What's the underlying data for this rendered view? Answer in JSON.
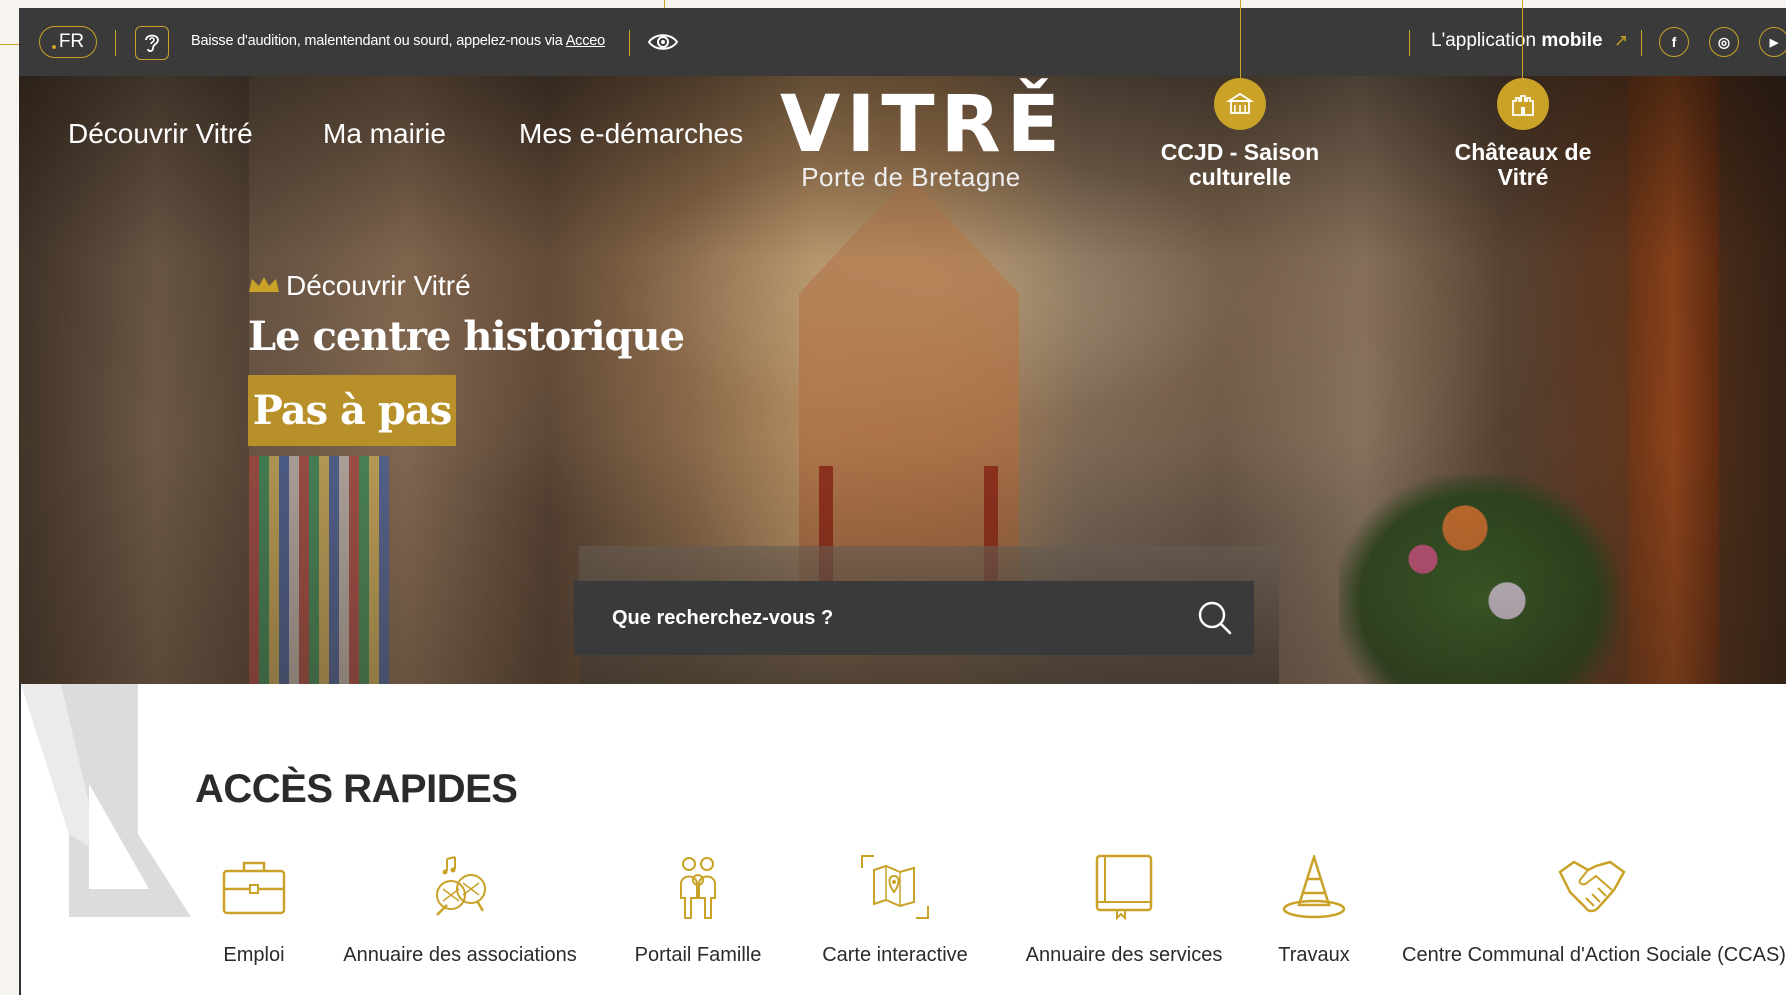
{
  "topbar": {
    "language": "FR",
    "accessibility_text": "Baisse d'audition, malentendant ou sourd, appelez-nous via",
    "accessibility_link": "Acceo",
    "app_link_prefix": "L'application",
    "app_link_bold": "mobile",
    "social": [
      {
        "name": "facebook",
        "glyph": "f"
      },
      {
        "name": "instagram",
        "glyph": "◎"
      },
      {
        "name": "youtube",
        "glyph": "▶"
      }
    ]
  },
  "nav": {
    "items": [
      "Découvrir Vitré",
      "Ma mairie",
      "Mes e-démarches"
    ]
  },
  "logo": {
    "word": "VITRĚ",
    "subtitle": "Porte de Bretagne"
  },
  "header_links": [
    {
      "label_line1": "CCJD - Saison",
      "label_line2": "culturelle",
      "icon": "theatre-icon"
    },
    {
      "label_line1": "Châteaux de",
      "label_line2": "Vitré",
      "icon": "castle-icon"
    }
  ],
  "hero": {
    "kicker": "Découvrir Vitré",
    "title": "Le centre historique",
    "cta": "Pas à pas"
  },
  "search": {
    "placeholder": "Que recherchez-vous ?"
  },
  "quick_access": {
    "title": "ACCÈS RAPIDES",
    "items": [
      {
        "label": "Emploi",
        "icon": "briefcase-icon"
      },
      {
        "label": "Annuaire des associations",
        "icon": "associations-icon"
      },
      {
        "label": "Portail Famille",
        "icon": "family-icon"
      },
      {
        "label": "Carte interactive",
        "icon": "map-icon"
      },
      {
        "label": "Annuaire des services",
        "icon": "book-icon"
      },
      {
        "label": "Travaux",
        "icon": "traffic-cone-icon"
      },
      {
        "label": "Centre Communal d'Action Sociale (CCAS)",
        "icon": "handshake-icon"
      }
    ]
  },
  "colors": {
    "gold": "#c9a227",
    "topbar": "#3a3a3a",
    "cta": "#b8902a",
    "text_dark": "#2b2b2b"
  }
}
